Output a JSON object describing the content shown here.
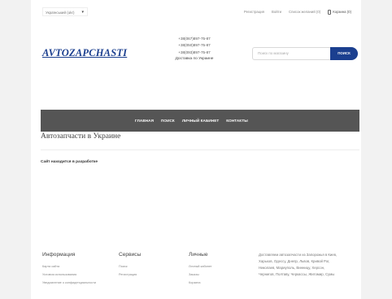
{
  "topbar": {
    "language": "Український (ukr)",
    "links": [
      "Регистрация",
      "Войти",
      "Список желаний (0)"
    ],
    "cart": "Корзина (0)"
  },
  "header": {
    "logo": "AVTOZAPCHASTI",
    "phones": [
      "+38(067)897-75-87",
      "+38(050)897-75-87",
      "+38(093)897-75-87"
    ],
    "delivery": "Доставка по Украине",
    "search_placeholder": "Поиск по магазину",
    "search_button": "ПОИСК"
  },
  "nav": {
    "items": [
      "ГЛАВНАЯ",
      "ПОИСК",
      "ЛИЧНЫЙ КАБИНЕТ",
      "КОНТАКТЫ"
    ]
  },
  "main": {
    "title": "Автозапчасти в Украине",
    "notice": "Сайт находится в разработке"
  },
  "footer": {
    "info": {
      "title": "Информация",
      "links": [
        "Карта сайта",
        "Условия использования",
        "Уведомление о конфиденциальности"
      ]
    },
    "services": {
      "title": "Сервисы",
      "links": [
        "Поиск",
        "Регистрация"
      ]
    },
    "personal": {
      "title": "Личные",
      "links": [
        "Личный кабинет",
        "Заказы",
        "Корзина"
      ]
    },
    "address": "Доставляем автозапчасти из Запорожья в Киев, Харьков, Одессу, Днепр, Львов, Кривой Рог, Николаев, Мариуполь, Винницу, Херсон, Чернигов, Полтаву, Черкассы, Житомир, Сумы"
  }
}
